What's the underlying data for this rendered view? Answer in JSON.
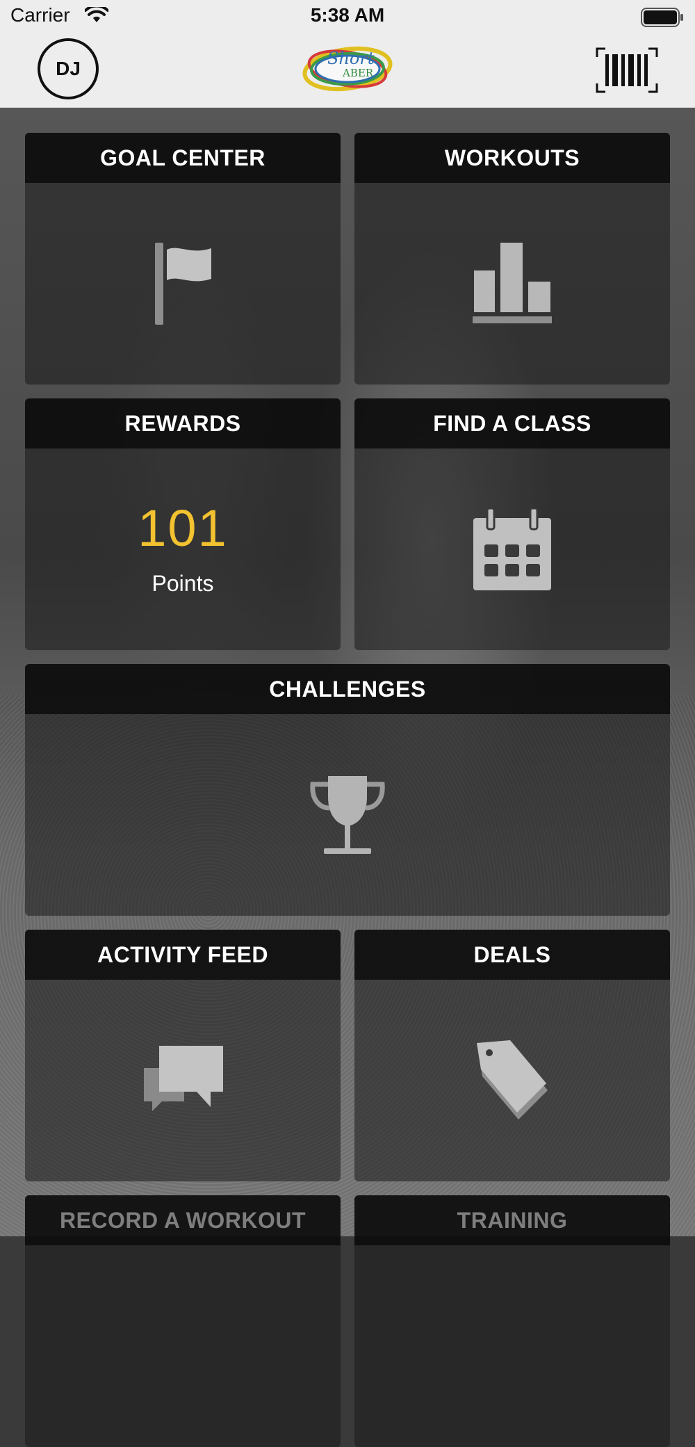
{
  "status_bar": {
    "carrier": "Carrier",
    "time": "5:38 AM"
  },
  "header": {
    "avatar_initials": "DJ",
    "logo_line1": "Short",
    "logo_line2": "ABER",
    "barcode_icon": "barcode-icon"
  },
  "tiles": {
    "goal_center": {
      "title": "GOAL CENTER",
      "icon": "flag-icon"
    },
    "workouts": {
      "title": "WORKOUTS",
      "icon": "bar-chart-icon"
    },
    "rewards": {
      "title": "REWARDS",
      "points_value": "101",
      "points_label": "Points"
    },
    "find_a_class": {
      "title": "FIND A CLASS",
      "icon": "calendar-icon"
    },
    "challenges": {
      "title": "CHALLENGES",
      "icon": "trophy-icon"
    },
    "activity_feed": {
      "title": "ACTIVITY FEED",
      "icon": "chat-bubbles-icon"
    },
    "deals": {
      "title": "DEALS",
      "icon": "tag-icon"
    },
    "record_a_workout": {
      "title": "RECORD A WORKOUT"
    },
    "training": {
      "title": "TRAINING"
    }
  },
  "colors": {
    "points_accent": "#f2c230",
    "tile_header": "#0a0a0a",
    "topbar": "#ededed"
  }
}
